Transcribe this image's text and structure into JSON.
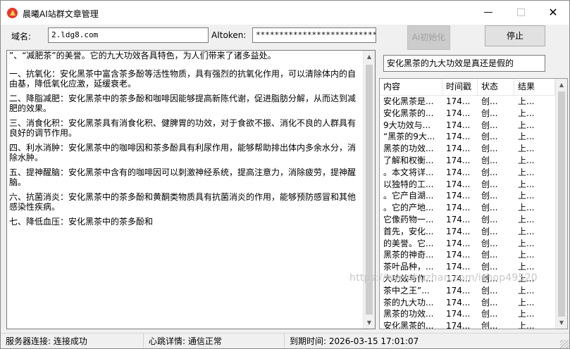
{
  "window": {
    "title": "晨曦AI站群文章管理",
    "min_glyph": "—",
    "close_glyph": "✕",
    "icon": "app-logo-icon"
  },
  "form": {
    "domain_label": "域名:",
    "domain_value": "2.ldg8.com",
    "token_label": "AItoken:",
    "token_value": "*************************************",
    "init_button": "Ai初始化",
    "stop_button": "停止"
  },
  "article": {
    "paragraphs": [
      "”、“减肥茶”的美誉。它的九大功效各具特色，为人们带来了诸多益处。",
      "一、抗氧化：安化黑茶中富含茶多酚等活性物质，具有强烈的抗氧化作用，可以清除体内的自由基，降低氧化应激，延缓衰老。",
      "二、降脂减肥：安化黑茶中的茶多酚和咖啡因能够提高新陈代谢，促进脂肪分解，从而达到减肥的效果。",
      "三、消食化积：安化黑茶具有消食化积、健脾胃的功效，对于食欲不振、消化不良的人群具有良好的调节作用。",
      "四、利水消肿：安化黑茶中的咖啡因和茶多酚具有利尿作用，能够帮助排出体内多余水分，消除水肿。",
      "五、提神醒脑：安化黑茶中含有的咖啡因可以刺激神经系统，提高注意力，消除疲劳，提神醒脑。",
      "六、抗菌消炎：安化黑茶中的茶多酚和黄酮类物质具有抗菌消炎的作用，能够预防感冒和其他感染性疾病。",
      "七、降低血压：安化黑茶中的茶多酚和"
    ],
    "scroll_up": "▲",
    "scroll_down": "▼"
  },
  "search": {
    "value": "安化黑茶的九大功效是真还是假的"
  },
  "table": {
    "columns": [
      "内容",
      "时间戳",
      "状态",
      "结果"
    ],
    "rows": [
      [
        "安化黑茶是...",
        "174...",
        "创...",
        "上..."
      ],
      [
        "安化黑茶的...",
        "174...",
        "创...",
        "上..."
      ],
      [
        "9大功效与...",
        "174...",
        "创...",
        "上..."
      ],
      [
        "“黑茶的9大...",
        "174...",
        "创...",
        "上..."
      ],
      [
        "黑茶的功效...",
        "174...",
        "创...",
        "上..."
      ],
      [
        "了解和权衡...",
        "174...",
        "创...",
        "上..."
      ],
      [
        "。本文将详...",
        "174...",
        "创...",
        "上..."
      ],
      [
        "以独特的工...",
        "174...",
        "创...",
        "上..."
      ],
      [
        "。它产自湖...",
        "174...",
        "创...",
        "上..."
      ],
      [
        "。它的产地...",
        "174...",
        "创...",
        "上..."
      ],
      [
        "它像药物一...",
        "174...",
        "创...",
        "上..."
      ],
      [
        "首先，安化...",
        "174...",
        "创...",
        "上..."
      ],
      [
        "的美誉。它...",
        "174...",
        "创...",
        "上..."
      ],
      [
        "黑茶的神奇...",
        "174...",
        "创...",
        "上..."
      ],
      [
        "茶叶品种，...",
        "174...",
        "创...",
        "上..."
      ],
      [
        "大功效与作...",
        "174...",
        "创...",
        "上..."
      ],
      [
        "茶中之王”...",
        "174...",
        "创...",
        "上..."
      ],
      [
        "茶的九大功...",
        "174...",
        "创...",
        "上..."
      ],
      [
        "黑茶的功效...",
        "174...",
        "创...",
        "上..."
      ],
      [
        "安化黑茶的...",
        "174...",
        "创...",
        "上..."
      ],
      [
        "黑茶，作为...",
        "174...",
        "创...",
        "上..."
      ]
    ]
  },
  "watermark": "https://www.huzhan.com/ishop49520",
  "status": {
    "server": "服务器连接: 连接成功",
    "heartbeat": "心跳详情: 通信正常",
    "expire": "到期时间: 2026-03-15 17:01:07"
  }
}
